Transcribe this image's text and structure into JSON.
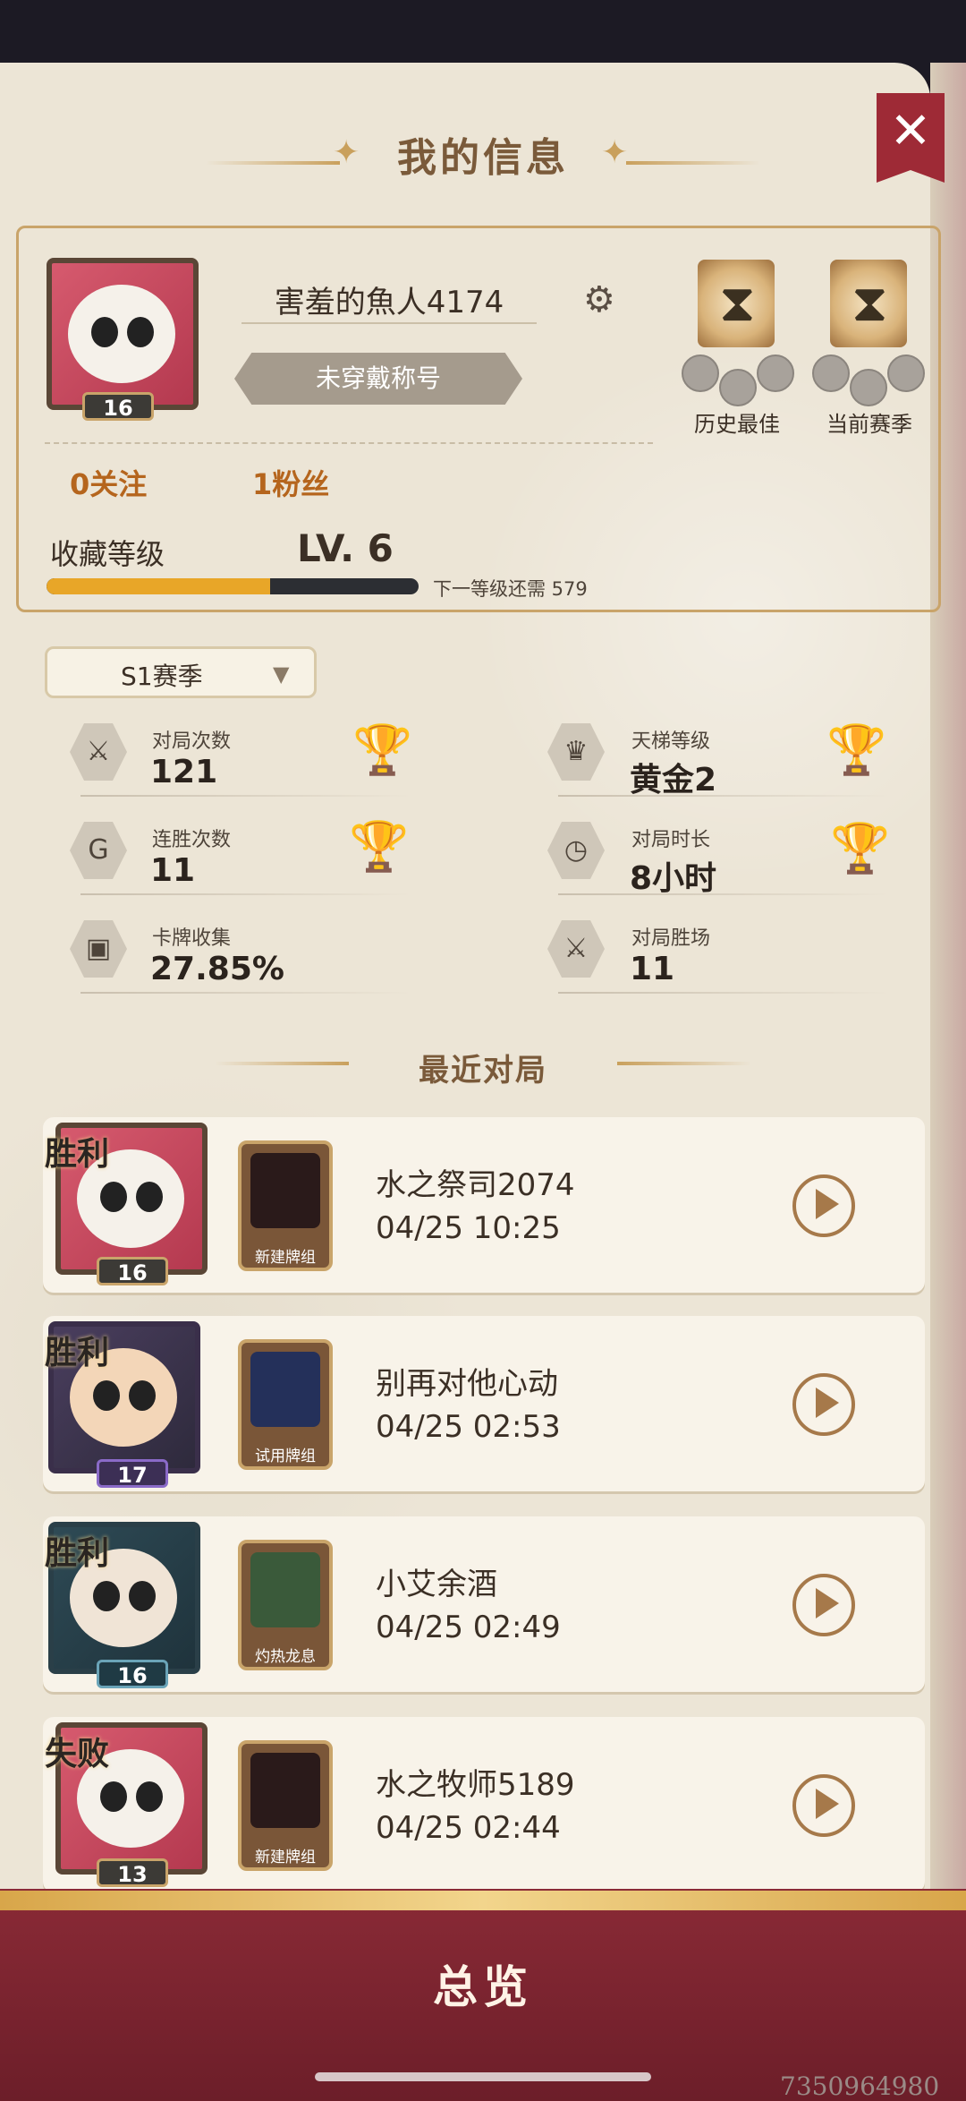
{
  "header": {
    "title": "我的信息",
    "close_label": "✕"
  },
  "profile": {
    "avatar_level": "16",
    "username": "害羞的魚人4174",
    "title_badge": "未穿戴称号",
    "badges": [
      {
        "label": "历史最佳"
      },
      {
        "label": "当前赛季"
      }
    ],
    "following": "0关注",
    "followers": "1粉丝",
    "collection_label": "收藏等级",
    "collection_level": "LV. 6",
    "xp_progress": 0.6,
    "next_level_text": "下一等级还需 579"
  },
  "season": {
    "selected": "S1赛季"
  },
  "stats": [
    {
      "label": "对局次数",
      "value": "121",
      "icon": "swords-icon",
      "trophy": "bronze-trophy-icon"
    },
    {
      "label": "天梯等级",
      "value": "黄金2",
      "icon": "crown-icon",
      "trophy": "gold-trophy-icon"
    },
    {
      "label": "连胜次数",
      "value": "11",
      "icon": "streak-icon",
      "trophy": "diamond-trophy-icon"
    },
    {
      "label": "对局时长",
      "value": "8小时",
      "icon": "clock-icon",
      "trophy": "silver-trophy-icon"
    },
    {
      "label": "卡牌收集",
      "value": "27.85%",
      "icon": "cards-icon",
      "trophy": ""
    },
    {
      "label": "对局胜场",
      "value": "11",
      "icon": "swords-icon",
      "trophy": ""
    }
  ],
  "recent": {
    "title": "最近对局",
    "matches": [
      {
        "result": "胜利",
        "level": "16",
        "deck": "新建牌组",
        "opponent": "水之祭司2074",
        "time": "04/25 10:25"
      },
      {
        "result": "胜利",
        "level": "17",
        "deck": "试用牌组",
        "opponent": "别再对他心动",
        "time": "04/25 02:53"
      },
      {
        "result": "胜利",
        "level": "16",
        "deck": "灼热龙息",
        "opponent": "小艾余酒",
        "time": "04/25 02:49"
      },
      {
        "result": "失败",
        "level": "13",
        "deck": "新建牌组",
        "opponent": "水之牧师5189",
        "time": "04/25 02:44"
      }
    ]
  },
  "footer": {
    "overview_label": "总览",
    "watermark": "7350964980"
  },
  "colors": {
    "panel": "#ece5d6",
    "accent_gold": "#c9a46a",
    "bottom_bar": "#7a2430",
    "xp_fill": "#e8a628"
  }
}
